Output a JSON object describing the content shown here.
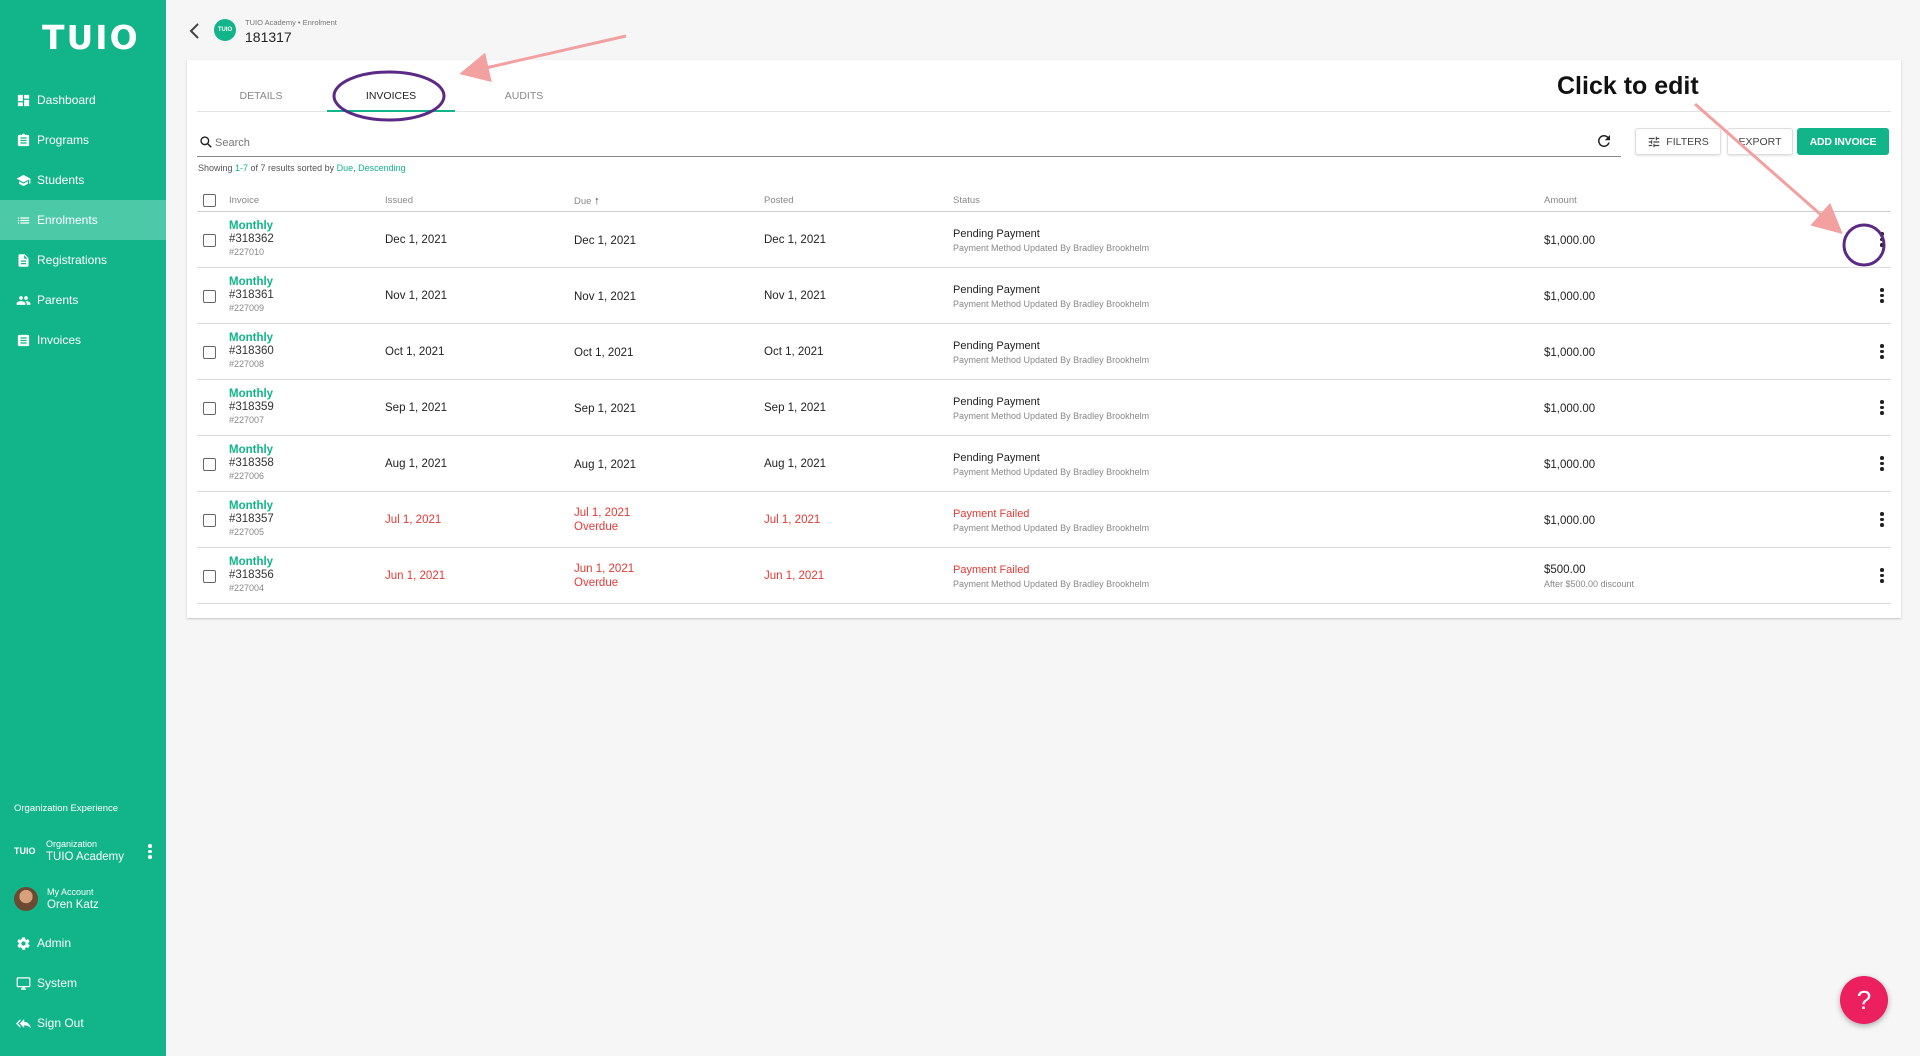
{
  "brand": {
    "logo": "TUIO",
    "accent": "#12b48a",
    "danger": "#e53935",
    "help_color": "#ec1f5f"
  },
  "sidebar": {
    "items": [
      {
        "label": "Dashboard",
        "icon": "dashboard-icon"
      },
      {
        "label": "Programs",
        "icon": "programs-icon"
      },
      {
        "label": "Students",
        "icon": "graduation-cap-icon"
      },
      {
        "label": "Enrolments",
        "icon": "list-icon",
        "active": true
      },
      {
        "label": "Registrations",
        "icon": "document-icon"
      },
      {
        "label": "Parents",
        "icon": "people-icon"
      },
      {
        "label": "Invoices",
        "icon": "invoice-icon"
      }
    ],
    "section_label": "Organization Experience",
    "org": {
      "logo": "TUIO",
      "caption": "Organization",
      "name": "TUIO Academy"
    },
    "account": {
      "caption": "My Account",
      "name": "Oren Katz"
    },
    "bottom_items": [
      {
        "label": "Admin",
        "icon": "gear-icon"
      },
      {
        "label": "System",
        "icon": "monitor-icon"
      },
      {
        "label": "Sign Out",
        "icon": "sign-out-icon"
      }
    ]
  },
  "header": {
    "logo": "TUIO",
    "breadcrumb": "TUIO Academy • Enrolment",
    "title": "181317"
  },
  "tabs": [
    "DETAILS",
    "INVOICES",
    "AUDITS"
  ],
  "toolbar": {
    "search_placeholder": "Search",
    "filters_label": "FILTERS",
    "export_label": "EXPORT",
    "add_label": "ADD INVOICE"
  },
  "results": {
    "prefix": "Showing ",
    "range": "1-7",
    "middle": " of 7 results sorted by ",
    "sort_field": "Due",
    "sep": ", ",
    "sort_dir": "Descending"
  },
  "columns": {
    "invoice": "Invoice",
    "issued": "Issued",
    "due": "Due",
    "due_sort_icon": "↑",
    "posted": "Posted",
    "status": "Status",
    "amount": "Amount"
  },
  "rows": [
    {
      "type": "Monthly",
      "number": "#318362",
      "sub": "#227010",
      "issued": "Dec 1, 2021",
      "due": "Dec 1, 2021",
      "due_note": "",
      "posted": "Dec 1, 2021",
      "status": "Pending Payment",
      "status_sub": "Payment Method Updated By Bradley Brookhelm",
      "amount": "$1,000.00",
      "amount_note": "",
      "overdue": false
    },
    {
      "type": "Monthly",
      "number": "#318361",
      "sub": "#227009",
      "issued": "Nov 1, 2021",
      "due": "Nov 1, 2021",
      "due_note": "",
      "posted": "Nov 1, 2021",
      "status": "Pending Payment",
      "status_sub": "Payment Method Updated By Bradley Brookhelm",
      "amount": "$1,000.00",
      "amount_note": "",
      "overdue": false
    },
    {
      "type": "Monthly",
      "number": "#318360",
      "sub": "#227008",
      "issued": "Oct 1, 2021",
      "due": "Oct 1, 2021",
      "due_note": "",
      "posted": "Oct 1, 2021",
      "status": "Pending Payment",
      "status_sub": "Payment Method Updated By Bradley Brookhelm",
      "amount": "$1,000.00",
      "amount_note": "",
      "overdue": false
    },
    {
      "type": "Monthly",
      "number": "#318359",
      "sub": "#227007",
      "issued": "Sep 1, 2021",
      "due": "Sep 1, 2021",
      "due_note": "",
      "posted": "Sep 1, 2021",
      "status": "Pending Payment",
      "status_sub": "Payment Method Updated By Bradley Brookhelm",
      "amount": "$1,000.00",
      "amount_note": "",
      "overdue": false
    },
    {
      "type": "Monthly",
      "number": "#318358",
      "sub": "#227006",
      "issued": "Aug 1, 2021",
      "due": "Aug 1, 2021",
      "due_note": "",
      "posted": "Aug 1, 2021",
      "status": "Pending Payment",
      "status_sub": "Payment Method Updated By Bradley Brookhelm",
      "amount": "$1,000.00",
      "amount_note": "",
      "overdue": false
    },
    {
      "type": "Monthly",
      "number": "#318357",
      "sub": "#227005",
      "issued": "Jul 1, 2021",
      "due": "Jul 1, 2021",
      "due_note": "Overdue",
      "posted": "Jul 1, 2021",
      "status": "Payment Failed",
      "status_sub": "Payment Method Updated By Bradley Brookhelm",
      "amount": "$1,000.00",
      "amount_note": "",
      "overdue": true
    },
    {
      "type": "Monthly",
      "number": "#318356",
      "sub": "#227004",
      "issued": "Jun 1, 2021",
      "due": "Jun 1, 2021",
      "due_note": "Overdue",
      "posted": "Jun 1, 2021",
      "status": "Payment Failed",
      "status_sub": "Payment Method Updated By Bradley Brookhelm",
      "amount": "$500.00",
      "amount_note": "After $500.00 discount",
      "overdue": true
    }
  ],
  "annotation": {
    "text": "Click to edit",
    "circle_color": "#5b2a86",
    "arrow_color": "#f2a0a0"
  },
  "help": {
    "label": "?"
  }
}
